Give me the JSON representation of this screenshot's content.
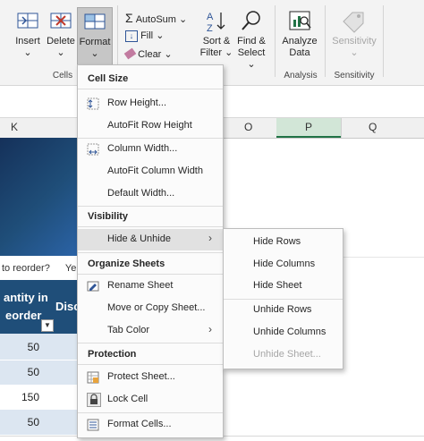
{
  "ribbon": {
    "insert_label": "Insert",
    "delete_label": "Delete",
    "format_label": "Format",
    "autosum_label": "AutoSum",
    "fill_label": "Fill",
    "clear_label": "Clear",
    "sort_filter_label1": "Sort &",
    "sort_filter_label2": "Filter",
    "find_select_label1": "Find &",
    "find_select_label2": "Select",
    "analyze_label1": "Analyze",
    "analyze_label2": "Data",
    "sensitivity_label": "Sensitivity",
    "group_cells": "Cells",
    "group_analysis": "Analysis",
    "group_sensitivity": "Sensitivity"
  },
  "columns": [
    "K",
    "O",
    "P",
    "Q"
  ],
  "sheet": {
    "reorder_text": "to reorder?",
    "reorder_text2": "Ye",
    "header_line1": "antity in",
    "header_line2": "eorder",
    "header_disc": "Disc",
    "values": [
      "50",
      "50",
      "150",
      "50"
    ]
  },
  "menu": {
    "cell_size_heading": "Cell Size",
    "row_height": "Row Height...",
    "autofit_row_height": "AutoFit Row Height",
    "column_width": "Column Width...",
    "autofit_column_width": "AutoFit Column Width",
    "default_width": "Default Width...",
    "visibility_heading": "Visibility",
    "hide_unhide": "Hide & Unhide",
    "organize_heading": "Organize Sheets",
    "rename_sheet": "Rename Sheet",
    "move_copy_sheet": "Move or Copy Sheet...",
    "tab_color": "Tab Color",
    "protection_heading": "Protection",
    "protect_sheet": "Protect Sheet...",
    "lock_cell": "Lock Cell",
    "format_cells": "Format Cells..."
  },
  "submenu": {
    "hide_rows": "Hide Rows",
    "hide_columns": "Hide Columns",
    "hide_sheet": "Hide Sheet",
    "unhide_rows": "Unhide Rows",
    "unhide_columns": "Unhide Columns",
    "unhide_sheet": "Unhide Sheet..."
  },
  "colors": {
    "excel_green": "#217346",
    "table_header_blue": "#1f4e79",
    "row_band": "#dce6f1",
    "highlight": "#e1e1e1"
  }
}
